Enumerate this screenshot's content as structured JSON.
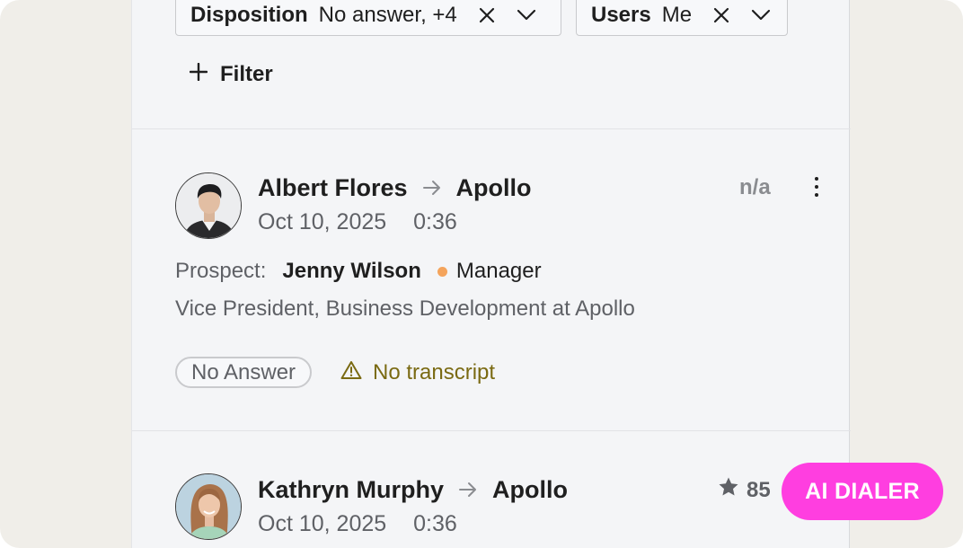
{
  "filters": [
    {
      "label": "Disposition",
      "value": "No answer, +4"
    },
    {
      "label": "Users",
      "value": "Me"
    }
  ],
  "add_filter_label": "Filter",
  "calls": [
    {
      "caller": "Albert Flores",
      "company": "Apollo",
      "date": "Oct 10, 2025",
      "duration": "0:36",
      "score_label": "n/a",
      "prospect_label": "Prospect:",
      "prospect_name": "Jenny Wilson",
      "prospect_role": "Manager",
      "prospect_title": "Vice President, Business Development at Apollo",
      "disposition_badge": "No Answer",
      "transcript_status": "No transcript"
    },
    {
      "caller": "Kathryn Murphy",
      "company": "Apollo",
      "date": "Oct 10, 2025",
      "duration": "0:36",
      "score": "85"
    }
  ],
  "ai_dialer_label": "AI DIALER",
  "colors": {
    "accent": "#ff3ee0",
    "role_dot": "#f4a45c",
    "warning": "#7a6a12"
  },
  "icons": {
    "chip_remove": "close-icon",
    "chip_dropdown": "chevron-down-icon",
    "add": "plus-icon",
    "direction": "arrow-right-icon",
    "menu": "kebab-menu-icon",
    "warning": "warning-triangle-icon",
    "score": "star-icon"
  }
}
